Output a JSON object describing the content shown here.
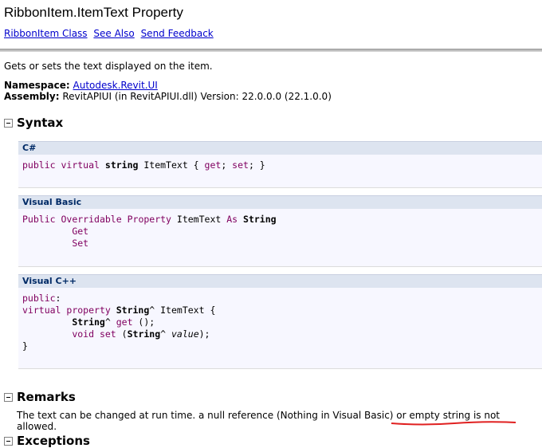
{
  "header": {
    "title": "RibbonItem.ItemText Property",
    "links": [
      "RibbonItem Class",
      "See Also",
      "Send Feedback"
    ]
  },
  "summary": "Gets or sets the text displayed on the item.",
  "namespace": {
    "label": "Namespace:",
    "value": "Autodesk.Revit.UI"
  },
  "assembly": {
    "label": "Assembly:",
    "value": "RevitAPIUI (in RevitAPIUI.dll) Version: 22.0.0.0 (22.1.0.0)"
  },
  "sections": {
    "syntax": "Syntax",
    "remarks": "Remarks",
    "exceptions": "Exceptions"
  },
  "code": {
    "csharp": {
      "lang": "C#",
      "line1": {
        "k1": "public",
        "k2": "virtual",
        "t": "string",
        "rest": " ItemText { ",
        "g": "get",
        "s": "; ",
        "st": "set",
        "end": "; }"
      }
    },
    "vb": {
      "lang": "Visual Basic",
      "line1": {
        "k1": "Public",
        "k2": "Overridable",
        "k3": "Property",
        "name": " ItemText ",
        "as": "As",
        "t": "String"
      },
      "get": "Get",
      "set": "Set"
    },
    "cpp": {
      "lang": "Visual C++",
      "public": "public",
      "colon": ":",
      "l2": {
        "k1": "virtual",
        "k2": "property",
        "t": "String",
        "rest": "^ ItemText {"
      },
      "l3": {
        "t": "String",
        "rest": "^ ",
        "g": "get",
        "end": " ();"
      },
      "l4": {
        "v": "void",
        "s": "set",
        "open": " (",
        "t": "String",
        "rest": "^ ",
        "val": "value",
        "end": ");"
      },
      "close": "}"
    }
  },
  "remarks": {
    "text_before": "The text can be changed at run time. a null reference (Nothing in Visual Basic) or ",
    "text_marked": "empty string is not allowed",
    "text_after": "."
  },
  "colors": {
    "link": "#0000cc",
    "keyword": "#800060",
    "annotation": "#e02020"
  }
}
